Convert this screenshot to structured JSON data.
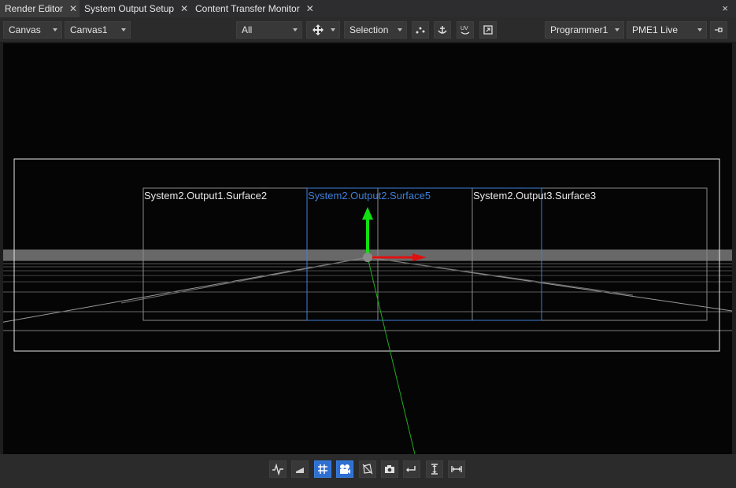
{
  "tabs": [
    {
      "label": "Render Editor",
      "active": true
    },
    {
      "label": "System Output Setup",
      "active": false
    },
    {
      "label": "Content Transfer Monitor",
      "active": false
    }
  ],
  "panel_close_label": "×",
  "toolbar": {
    "view_mode": "Canvas",
    "canvas": "Canvas1",
    "filter": "All",
    "transform_icon": "move-arrows-icon",
    "selection_mode": "Selection",
    "programmer": "Programmer1",
    "live": "PME1 Live",
    "pin_icon": "pin-icon"
  },
  "viewport": {
    "surfaces": [
      {
        "label": "System2.Output1.Surface2",
        "selected": false
      },
      {
        "label": "System2.Output2.Surface5",
        "selected": true
      },
      {
        "label": "System2.Output3.Surface3",
        "selected": false
      }
    ],
    "gizmo_colors": {
      "x_axis": "#e01010",
      "y_axis": "#10e010",
      "origin": "#8a8a8a",
      "selected": "#3f7fd8"
    }
  },
  "bottom_toolbar": [
    {
      "icon": "waveform-icon",
      "active": false
    },
    {
      "icon": "ramp-icon",
      "active": false
    },
    {
      "icon": "grid-icon",
      "active": true
    },
    {
      "icon": "camera-icon",
      "active": true
    },
    {
      "icon": "hide-geometry-icon",
      "active": false
    },
    {
      "icon": "snapshot-icon",
      "active": false
    },
    {
      "icon": "undo-arrow-icon",
      "active": false
    },
    {
      "icon": "vertical-fit-icon",
      "active": false
    },
    {
      "icon": "horizontal-fit-icon",
      "active": false
    }
  ]
}
